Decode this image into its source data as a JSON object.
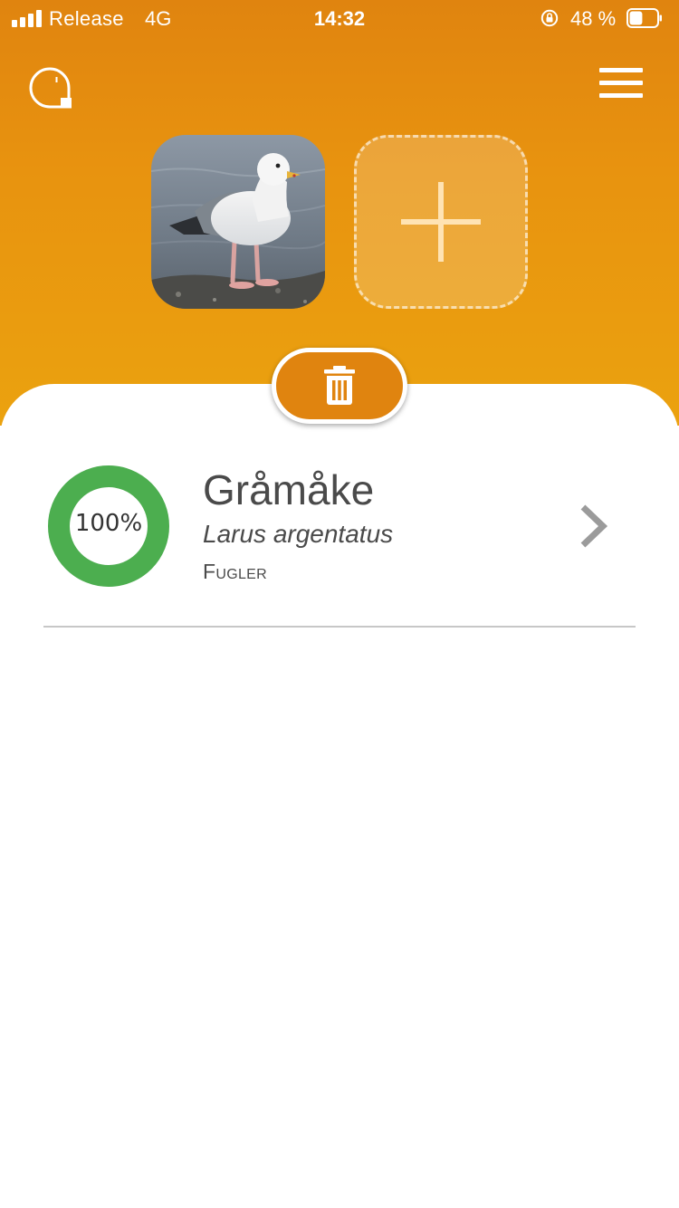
{
  "status_bar": {
    "carrier": "Release",
    "network": "4G",
    "time": "14:32",
    "battery_percent": "48 %",
    "battery_level": 0.48,
    "icons": [
      "signal-icon",
      "orientation-lock-icon",
      "battery-icon"
    ]
  },
  "app_bar": {
    "logo_icon": "app-logo-icon",
    "menu_icon": "hamburger-menu-icon"
  },
  "photos": {
    "items": [
      {
        "subject": "seagull-photo"
      }
    ],
    "add_icon": "plus-icon"
  },
  "actions": {
    "delete_icon": "trash-icon"
  },
  "results": [
    {
      "confidence_label": "100%",
      "confidence": 1.0,
      "common_name": "Gråmåke",
      "scientific_name": "Larus argentatus",
      "group": "Fugler",
      "chevron_icon": "chevron-right-icon"
    }
  ],
  "colors": {
    "header_top": "#e0840f",
    "header_bottom": "#eba20f",
    "accent": "#e0840f",
    "confidence_ring": "#4cae4f",
    "text": "#4a4a4a",
    "divider": "#c7c7c7"
  }
}
